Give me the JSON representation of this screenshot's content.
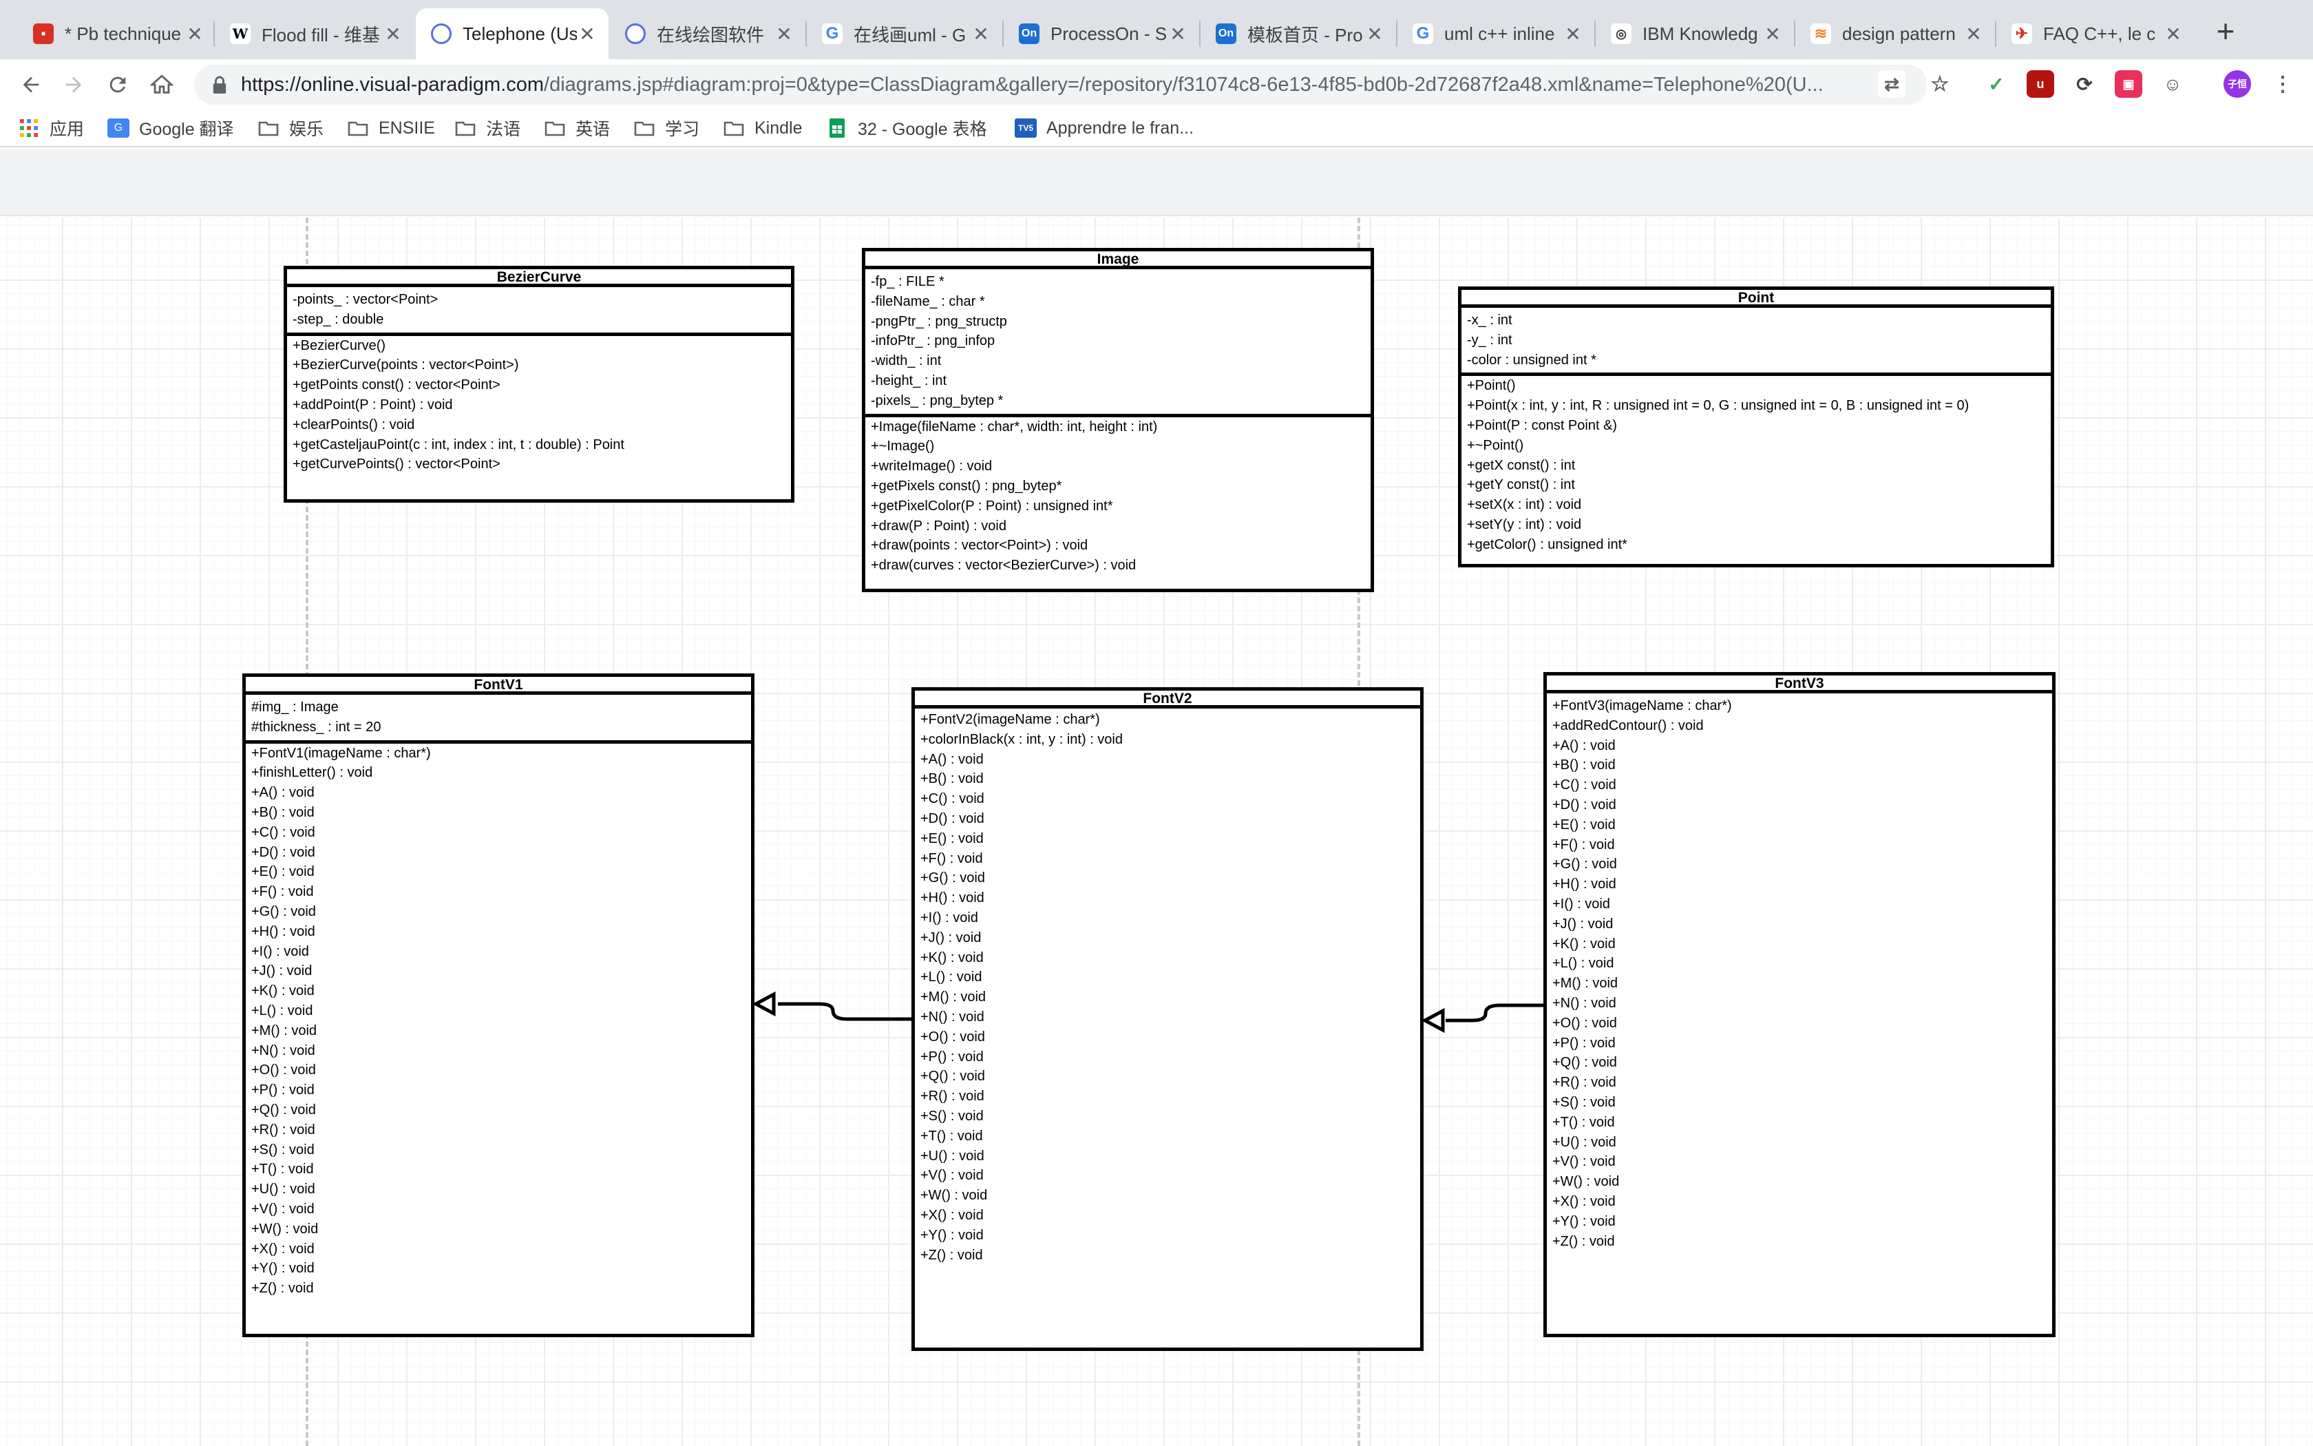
{
  "browser": {
    "tabs": [
      {
        "title": "* Pb technique",
        "icon": "red-favicon"
      },
      {
        "title": "Flood fill - 维基",
        "icon": "wikipedia-favicon"
      },
      {
        "title": "Telephone (Us",
        "icon": "visual-paradigm-favicon",
        "active": true
      },
      {
        "title": "在线绘图软件",
        "icon": "visual-paradigm-favicon"
      },
      {
        "title": "在线画uml - G",
        "icon": "google-favicon"
      },
      {
        "title": "ProcessOn - S",
        "icon": "processon-favicon"
      },
      {
        "title": "模板首页 - Pro",
        "icon": "processon-favicon"
      },
      {
        "title": "uml c++ inline",
        "icon": "google-favicon"
      },
      {
        "title": "IBM Knowledg",
        "icon": "ibm-favicon"
      },
      {
        "title": "design pattern",
        "icon": "stackoverflow-favicon"
      },
      {
        "title": "FAQ C++, le c",
        "icon": "developpez-favicon"
      }
    ],
    "new_tab": "+",
    "close_glyph": "✕",
    "url_host": "https://online.visual-paradigm.com",
    "url_path": "/diagrams.jsp#diagram:proj=0&type=ClassDiagram&gallery=/repository/f31074c8-6e13-4f85-bd0b-2d72687f2a48.xml&name=Telephone%20(U...",
    "profile_label": "子恒",
    "bookmarks": [
      {
        "label": "应用",
        "icon": "apps-grid-icon"
      },
      {
        "label": "Google 翻译",
        "icon": "google-translate-icon"
      },
      {
        "label": "娱乐",
        "icon": "folder-icon"
      },
      {
        "label": "ENSIIE",
        "icon": "folder-icon"
      },
      {
        "label": "法语",
        "icon": "folder-icon"
      },
      {
        "label": "英语",
        "icon": "folder-icon"
      },
      {
        "label": "学习",
        "icon": "folder-icon"
      },
      {
        "label": "Kindle",
        "icon": "folder-icon"
      },
      {
        "label": "32 - Google 表格",
        "icon": "google-sheets-icon"
      },
      {
        "label": "Apprendre le fran...",
        "icon": "tv5-icon"
      }
    ]
  },
  "diagram": {
    "classes": [
      {
        "name": "BezierCurve",
        "attributes": [
          "-points_ : vector<Point>",
          "-step_ : double"
        ],
        "operations": [
          "+BezierCurve()",
          "+BezierCurve(points : vector<Point>)",
          "+getPoints const() : vector<Point>",
          "+addPoint(P : Point) : void",
          "+clearPoints() : void",
          "+getCasteljauPoint(c : int, index : int, t : double) : Point",
          "+getCurvePoints() : vector<Point>"
        ]
      },
      {
        "name": "Image",
        "attributes": [
          "-fp_ : FILE *",
          "-fileName_ : char *",
          "-pngPtr_ : png_structp",
          "-infoPtr_ : png_infop",
          "-width_ : int",
          "-height_ : int",
          "-pixels_ : png_bytep *"
        ],
        "operations": [
          "+Image(fileName : char*, width: int, height : int)",
          "+~Image()",
          "+writeImage() : void",
          "+getPixels const() : png_bytep*",
          "+getPixelColor(P : Point) : unsigned int*",
          "+draw(P : Point) : void",
          "+draw(points : vector<Point>) : void",
          "+draw(curves : vector<BezierCurve>) : void"
        ]
      },
      {
        "name": "Point",
        "attributes": [
          "-x_ : int",
          "-y_ : int",
          "-color : unsigned int *"
        ],
        "operations": [
          "+Point()",
          "+Point(x : int, y : int, R : unsigned int = 0, G : unsigned int = 0, B : unsigned int = 0)",
          "+Point(P : const Point &)",
          "+~Point()",
          "+getX const() : int",
          "+getY const() : int",
          "+setX(x : int) : void",
          "+setY(y : int) : void",
          "+getColor() : unsigned int*"
        ]
      },
      {
        "name": "FontV1",
        "attributes": [
          "#img_ : Image",
          "#thickness_ : int = 20"
        ],
        "operations": [
          "+FontV1(imageName : char*)",
          "+finishLetter() : void",
          "+A() : void",
          "+B() : void",
          "+C() : void",
          "+D() : void",
          "+E() : void",
          "+F() : void",
          "+G() : void",
          "+H() : void",
          "+I() : void",
          "+J() : void",
          "+K() : void",
          "+L() : void",
          "+M() : void",
          "+N() : void",
          "+O() : void",
          "+P() : void",
          "+Q() : void",
          "+R() : void",
          "+S() : void",
          "+T() : void",
          "+U() : void",
          "+V() : void",
          "+W() : void",
          "+X() : void",
          "+Y() : void",
          "+Z() : void"
        ]
      },
      {
        "name": "FontV2",
        "attributes": [],
        "operations": [
          "+FontV2(imageName : char*)",
          "+colorInBlack(x : int, y : int) : void",
          "+A() : void",
          "+B() : void",
          "+C() : void",
          "+D() : void",
          "+E() : void",
          "+F() : void",
          "+G() : void",
          "+H() : void",
          "+I() : void",
          "+J() : void",
          "+K() : void",
          "+L() : void",
          "+M() : void",
          "+N() : void",
          "+O() : void",
          "+P() : void",
          "+Q() : void",
          "+R() : void",
          "+S() : void",
          "+T() : void",
          "+U() : void",
          "+V() : void",
          "+W() : void",
          "+X() : void",
          "+Y() : void",
          "+Z() : void"
        ]
      },
      {
        "name": "FontV3",
        "attributes": [],
        "operations": [
          "+FontV3(imageName : char*)",
          "+addRedContour() : void",
          "+A() : void",
          "+B() : void",
          "+C() : void",
          "+D() : void",
          "+E() : void",
          "+F() : void",
          "+G() : void",
          "+H() : void",
          "+I() : void",
          "+J() : void",
          "+K() : void",
          "+L() : void",
          "+M() : void",
          "+N() : void",
          "+O() : void",
          "+P() : void",
          "+Q() : void",
          "+R() : void",
          "+S() : void",
          "+T() : void",
          "+U() : void",
          "+V() : void",
          "+W() : void",
          "+X() : void",
          "+Y() : void",
          "+Z() : void"
        ]
      }
    ],
    "relations": [
      {
        "type": "generalization",
        "from": "FontV2",
        "to": "FontV1"
      },
      {
        "type": "generalization",
        "from": "FontV3",
        "to": "FontV2"
      }
    ]
  },
  "colors": {
    "tab_strip": "#dee1e6",
    "omnibox": "#f1f3f4",
    "canvas_grid": "#ececec",
    "uml_border": "#000000",
    "profile_avatar": "#9334e6"
  }
}
